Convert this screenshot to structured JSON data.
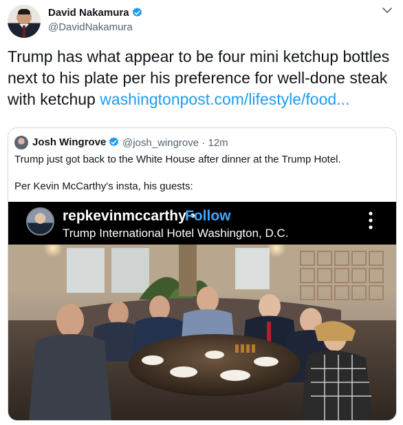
{
  "tweet": {
    "author_name": "David Nakamura",
    "author_handle": "@DavidNakamura",
    "text_before_link": "Trump has what appear to be four mini ketchup bottles next to his plate per his preference for well-done steak with ketchup ",
    "link_text": "washingtonpost.com/lifestyle/food..."
  },
  "quoted_tweet": {
    "author_name": "Josh Wingrove",
    "author_handle": "@josh_wingrove",
    "separator": "·",
    "time": "12m",
    "line1": "Trump just got back to the White House after dinner at the Trump Hotel.",
    "line2": "Per Kevin McCarthy's insta, his guests:"
  },
  "instagram_screenshot": {
    "username": "repkevinmccarthy",
    "dot": "•",
    "follow_label": "Follow",
    "location": "Trump International Hotel Washington, D.C."
  },
  "colors": {
    "link": "#1d9bf0",
    "verified": "#1d9bf0",
    "secondary_text": "#536471",
    "instagram_follow": "#3fa7ff"
  },
  "icons": {
    "verified": "verified-badge-icon",
    "more": "more-options-icon",
    "ig_menu": "vertical-dots-icon"
  }
}
